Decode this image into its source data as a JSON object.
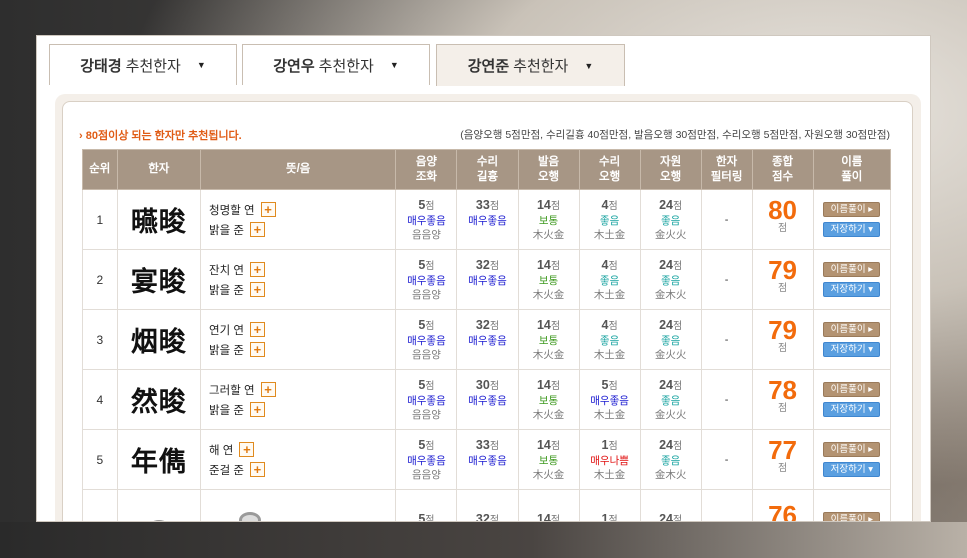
{
  "tabs": [
    {
      "name": "강태경",
      "suffix": "추천한자"
    },
    {
      "name": "강연우",
      "suffix": "추천한자"
    },
    {
      "name": "강연준",
      "suffix": "추천한자"
    }
  ],
  "notice": "› 80점이상 되는 한자만 추천됩니다.",
  "criteria": "(음양오행 5점만점, 수리길흉 40점만점, 발음오행 30점만점, 수리오행 5점만점, 자원오행 30점만점)",
  "headers": {
    "rank": "순위",
    "hanja": "한자",
    "meaning": "뜻/음",
    "yinyang_1": "음양",
    "yinyang_2": "조화",
    "suri_1": "수리",
    "suri_2": "길흉",
    "pron_1": "발음",
    "pron_2": "오행",
    "suriel_1": "수리",
    "suriel_2": "오행",
    "source_1": "자원",
    "source_2": "오행",
    "filter_1": "한자",
    "filter_2": "필터링",
    "total_1": "종합",
    "total_2": "점수",
    "btn_1": "이름",
    "btn_2": "풀이"
  },
  "labels": {
    "pt": "점",
    "filter_value": "-",
    "btn_name": "이름풀이 ▸",
    "btn_save": "저장하기 ▾",
    "plus": "+"
  },
  "rows": [
    {
      "rank": "1",
      "hanja": "曣晙",
      "m1": "청명할 연",
      "m2": "밝을 준",
      "yy": "5",
      "yy_text": "매우좋음",
      "yy_sub": "음음양",
      "sr": "33",
      "sr_text": "매우좋음",
      "po": "14",
      "po_text": "보통",
      "po_sub": "木火金",
      "so": "4",
      "so_text": "좋음",
      "so_sub": "木土金",
      "jw": "24",
      "jw_text": "좋음",
      "jw_sub": "金火火",
      "total": "80"
    },
    {
      "rank": "2",
      "hanja": "宴晙",
      "m1": "잔치 연",
      "m2": "밝을 준",
      "yy": "5",
      "yy_text": "매우좋음",
      "yy_sub": "음음양",
      "sr": "32",
      "sr_text": "매우좋음",
      "po": "14",
      "po_text": "보통",
      "po_sub": "木火金",
      "so": "4",
      "so_text": "좋음",
      "so_sub": "木土金",
      "jw": "24",
      "jw_text": "좋음",
      "jw_sub": "金木火",
      "total": "79"
    },
    {
      "rank": "3",
      "hanja": "烟晙",
      "m1": "연기 연",
      "m2": "밝을 준",
      "yy": "5",
      "yy_text": "매우좋음",
      "yy_sub": "음음양",
      "sr": "32",
      "sr_text": "매우좋음",
      "po": "14",
      "po_text": "보통",
      "po_sub": "木火金",
      "so": "4",
      "so_text": "좋음",
      "so_sub": "木土金",
      "jw": "24",
      "jw_text": "좋음",
      "jw_sub": "金火火",
      "total": "79"
    },
    {
      "rank": "4",
      "hanja": "然晙",
      "m1": "그러할 연",
      "m2": "밝을 준",
      "yy": "5",
      "yy_text": "매우좋음",
      "yy_sub": "음음양",
      "sr": "30",
      "sr_text": "매우좋음",
      "po": "14",
      "po_text": "보통",
      "po_sub": "木火金",
      "so": "5",
      "so_text": "매우좋음",
      "so_sub": "木土金",
      "jw": "24",
      "jw_text": "좋음",
      "jw_sub": "金火火",
      "total": "78"
    },
    {
      "rank": "5",
      "hanja": "年儁",
      "m1": "해 연",
      "m2": "준걸 준",
      "yy": "5",
      "yy_text": "매우좋음",
      "yy_sub": "음음양",
      "sr": "33",
      "sr_text": "매우좋음",
      "po": "14",
      "po_text": "보통",
      "po_sub": "木火金",
      "so": "1",
      "so_text": "매우나쁨",
      "so_sub": "木土金",
      "jw": "24",
      "jw_text": "좋음",
      "jw_sub": "金木火",
      "total": "77"
    }
  ],
  "partial_row": {
    "yy": "5",
    "sr": "32",
    "po": "14",
    "so": "1",
    "jw": "24",
    "total": "76"
  }
}
